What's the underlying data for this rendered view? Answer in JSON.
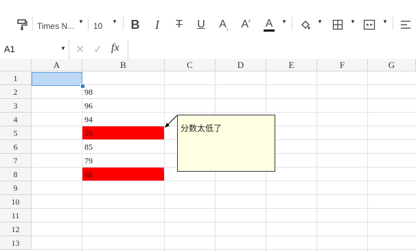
{
  "toolbar": {
    "font_name": "Times N...",
    "font_size": "10",
    "items": [
      "format-painter-icon",
      "bold-icon",
      "italic-icon",
      "strikethrough-icon",
      "underline-icon",
      "subscript-icon",
      "superscript-icon",
      "font-color-icon",
      "fill-color-icon",
      "borders-icon",
      "merge-cells-icon",
      "align-icon"
    ]
  },
  "formula_bar": {
    "cell_ref": "A1",
    "fx_label": "fx",
    "value": ""
  },
  "columns": [
    "A",
    "B",
    "C",
    "D",
    "E",
    "F",
    "G"
  ],
  "rows": [
    "1",
    "2",
    "3",
    "4",
    "5",
    "6",
    "7",
    "8",
    "9",
    "10",
    "11",
    "12",
    "13"
  ],
  "column_b_values": [
    "",
    "98",
    "96",
    "94",
    "59",
    "85",
    "79",
    "68"
  ],
  "highlight_color": "#ff0000",
  "note": {
    "text": "分数太低了",
    "attached_to": "B5"
  }
}
